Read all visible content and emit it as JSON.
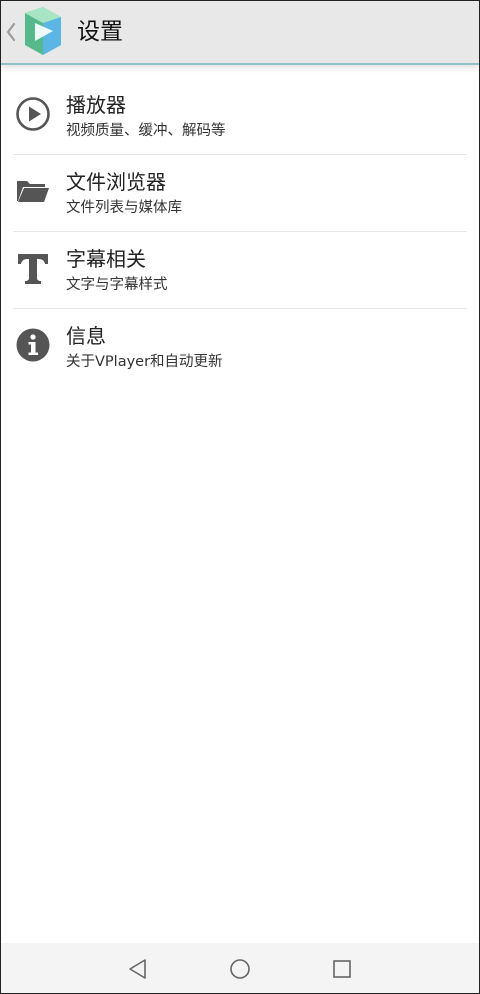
{
  "header": {
    "title": "设置"
  },
  "settings": {
    "items": [
      {
        "icon": "play-circle-icon",
        "title": "播放器",
        "subtitle": "视频质量、缓冲、解码等"
      },
      {
        "icon": "folder-icon",
        "title": "文件浏览器",
        "subtitle": "文件列表与媒体库"
      },
      {
        "icon": "text-t-icon",
        "title": "字幕相关",
        "subtitle": "文字与字幕样式"
      },
      {
        "icon": "info-icon",
        "title": "信息",
        "subtitle": "关于VPlayer和自动更新"
      }
    ]
  },
  "navbar": {
    "buttons": [
      "back-triangle-icon",
      "home-circle-icon",
      "recents-square-icon"
    ]
  },
  "colors": {
    "appbar_bg": "#e8e8e8",
    "appbar_underline": "#8fc2c6",
    "icon_gray": "#555555",
    "text": "#222222"
  }
}
